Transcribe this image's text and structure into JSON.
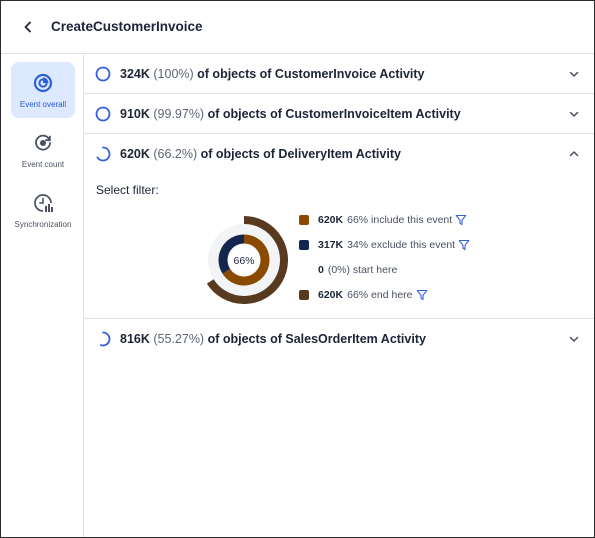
{
  "header": {
    "title": "CreateCustomerInvoice"
  },
  "sidebar": {
    "items": [
      {
        "label": "Event overall",
        "icon": "pie-chart-icon",
        "active": true
      },
      {
        "label": "Event count",
        "icon": "refresh-target-icon",
        "active": false
      },
      {
        "label": "Synchronization",
        "icon": "clock-bars-icon",
        "active": false
      }
    ]
  },
  "rows": [
    {
      "count": "324K",
      "pct": "(100%)",
      "rest": "of objects of CustomerInvoice Activity",
      "progress": 1.0,
      "expanded": false
    },
    {
      "count": "910K",
      "pct": "(99.97%)",
      "rest": "of objects of CustomerInvoiceItem Activity",
      "progress": 0.9997,
      "expanded": false
    },
    {
      "count": "620K",
      "pct": "(66.2%)",
      "rest": "of objects of DeliveryItem Activity",
      "progress": 0.662,
      "expanded": true
    },
    {
      "count": "816K",
      "pct": "(55.27%)",
      "rest": "of objects of SalesOrderItem Activity",
      "progress": 0.5527,
      "expanded": false
    }
  ],
  "detail": {
    "filter_label": "Select filter:",
    "center_label": "66%",
    "inner_fraction": 0.66,
    "outer_fraction": 0.66,
    "legend": [
      {
        "value": "620K",
        "desc": "66% include this event",
        "color": "#8a4a00",
        "filter": true
      },
      {
        "value": "317K",
        "desc": "34% exclude this event",
        "color": "#14264f",
        "filter": true
      },
      {
        "value": "0",
        "desc": "(0%) start here",
        "color": "",
        "filter": false
      },
      {
        "value": "620K",
        "desc": "66% end here",
        "color": "#573a1f",
        "filter": true
      }
    ]
  },
  "colors": {
    "accent": "#3361e0",
    "include": "#8a4a00",
    "exclude": "#14264f",
    "end": "#573a1f",
    "track": "#f3f4f6"
  }
}
